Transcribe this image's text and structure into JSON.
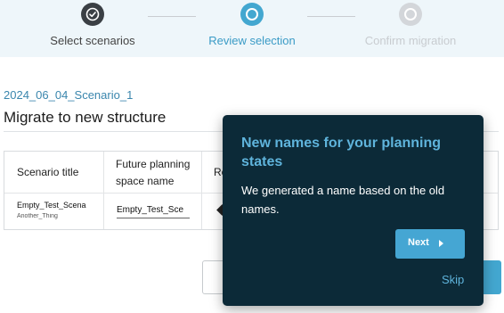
{
  "stepper": {
    "steps": [
      {
        "label": "Select scenarios",
        "state": "completed",
        "icon": "check-icon"
      },
      {
        "label": "Review selection",
        "state": "current",
        "icon": "ring-icon"
      },
      {
        "label": "Confirm migration",
        "state": "upcoming",
        "icon": "ring-icon"
      }
    ]
  },
  "header": {
    "scenario": "2024_06_04_Scenario_1",
    "title": "Migrate to new structure"
  },
  "table": {
    "columns": [
      "Scenario title",
      "Future planning space name",
      "Re"
    ],
    "rows": [
      {
        "scenario_title": "Empty_Test_Scena",
        "scenario_subtitle": "Another_Thing",
        "future_name": "Empty_Test_Sce"
      }
    ]
  },
  "tour": {
    "title": "New names for your planning states",
    "body": "We generated a name based on the old names.",
    "next_label": "Next",
    "skip_label": "Skip"
  },
  "colors": {
    "accent": "#43a7d0",
    "popover_bg": "#0c2a38",
    "popover_title": "#5fb4dc",
    "completed_step": "#3a3f44",
    "upcoming_step": "#d3d6da"
  }
}
